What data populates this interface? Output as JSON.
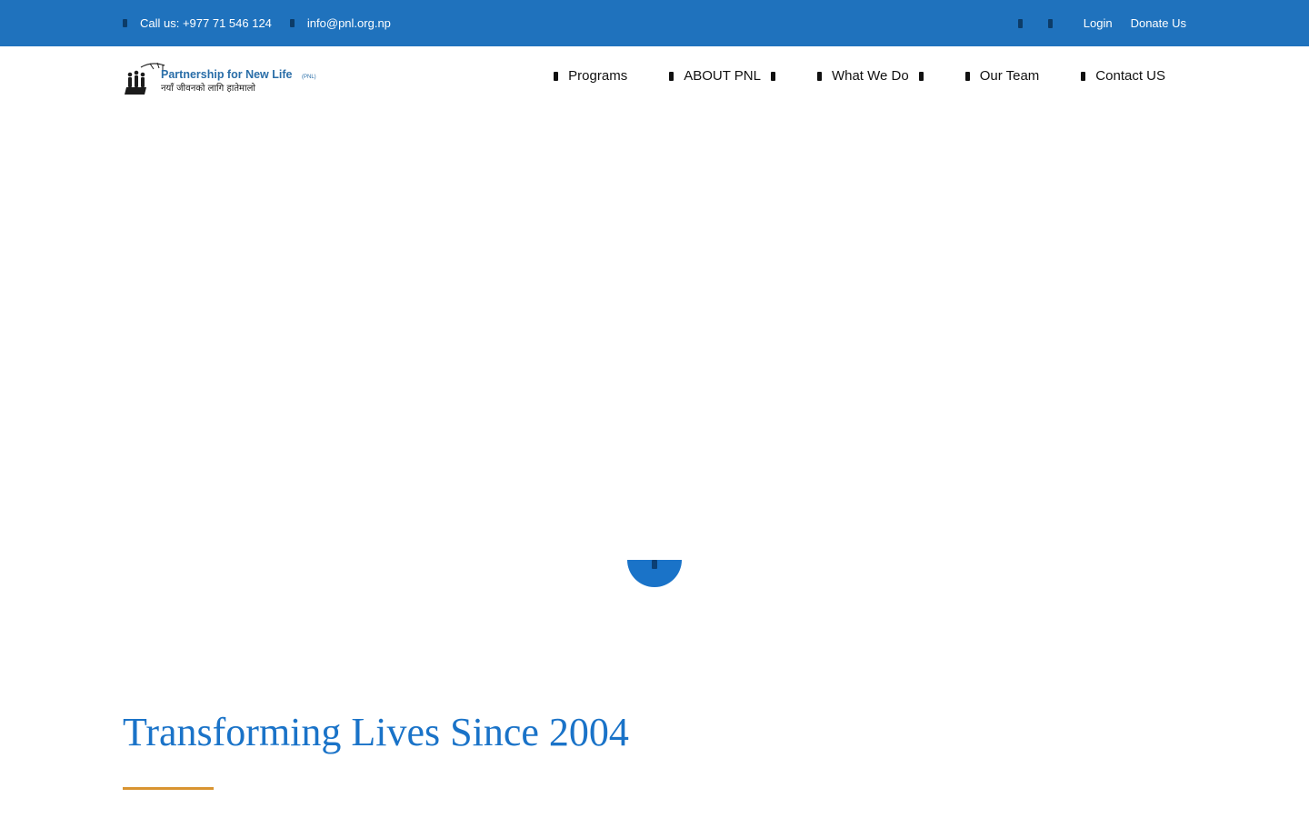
{
  "topbar": {
    "phone_text": "Call us: +977 71 546 124",
    "email_text": "info@pnl.org.np",
    "phone_icon": "phone-icon",
    "email_icon": "envelope-icon",
    "social": [
      "facebook-icon",
      "twitter-icon"
    ],
    "login_label": "Login",
    "donate_label": "Donate Us",
    "bg_color": "#1f72bd"
  },
  "logo": {
    "title": "Partnership for New Life",
    "abbr": "(PNL)",
    "subtitle": "नयाँ जीवनको लागि हातेमालो"
  },
  "nav": {
    "items": [
      {
        "label": "Programs",
        "icon": "home-icon",
        "has_dropdown": false
      },
      {
        "label": "ABOUT PNL",
        "icon": "info-icon",
        "has_dropdown": true
      },
      {
        "label": "What We Do",
        "icon": "briefcase-icon",
        "has_dropdown": true
      },
      {
        "label": "Our Team",
        "icon": "users-icon",
        "has_dropdown": false
      },
      {
        "label": "Contact US",
        "icon": "phone-icon",
        "has_dropdown": false
      }
    ]
  },
  "hero": {
    "scroll_icon": "chevron-down-icon",
    "accent_color": "#1a73c8"
  },
  "section": {
    "title": "Transforming Lives Since 2004",
    "rule_color": "#d99431"
  }
}
